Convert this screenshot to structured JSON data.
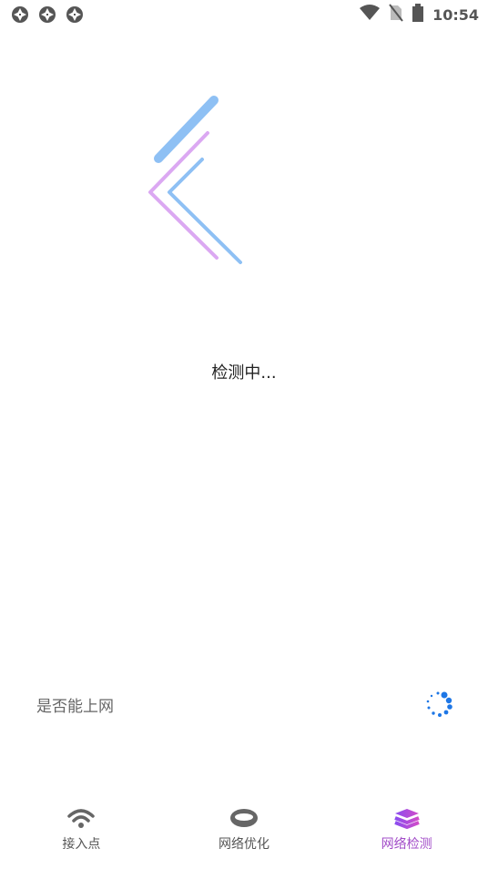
{
  "status_bar": {
    "time": "10:54",
    "notification_icons": [
      "aperture-icon",
      "aperture-icon",
      "aperture-icon"
    ],
    "right_icons": [
      "wifi-icon",
      "no-sim-icon",
      "battery-icon"
    ]
  },
  "main": {
    "status_text": "检测中..."
  },
  "check": {
    "label": "是否能上网"
  },
  "nav": {
    "items": [
      {
        "label": "接入点",
        "icon": "wifi-icon"
      },
      {
        "label": "网络优化",
        "icon": "ring-icon"
      },
      {
        "label": "网络检测",
        "icon": "layers-icon"
      }
    ],
    "active_index": 2,
    "active_color": "#a24cc8"
  },
  "colors": {
    "accent_blue": "#8ec0f4",
    "accent_purple": "#dba8f2",
    "spinner_blue": "#1e77e6"
  }
}
